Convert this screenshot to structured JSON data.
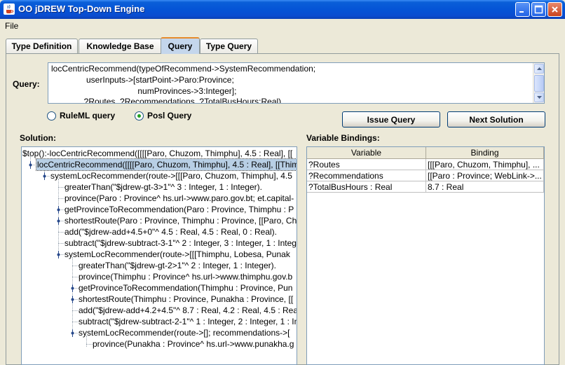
{
  "window": {
    "title": "OO jDREW Top-Down Engine"
  },
  "menu": {
    "file": "File"
  },
  "tabs": [
    {
      "label": "Type Definition"
    },
    {
      "label": "Knowledge Base"
    },
    {
      "label": "Query",
      "active": true
    },
    {
      "label": "Type Query"
    }
  ],
  "query": {
    "label": "Query:",
    "lines": [
      "locCentricRecommend(typeOfRecommend->SystemRecommendation;",
      "               userInputs->[startPoint->Paro:Province;",
      "                                     numProvinces->3:Integer];",
      "              ?Routes, ?Recommendations, ?TotalBusHours:Real)"
    ]
  },
  "options": {
    "ruleml": {
      "label": "RuleML query",
      "selected": false
    },
    "posl": {
      "label": "Posl Query",
      "selected": true
    }
  },
  "buttons": {
    "issue": "Issue Query",
    "next": "Next Solution"
  },
  "solution": {
    "label": "Solution:",
    "rows": [
      {
        "text": "$top():-locCentricRecommend([[[[Paro, Chuzom, Thimphu], 4.5 : Real], [["
      },
      {
        "text": "locCentricRecommend([[[[Paro, Chuzom, Thimphu], 4.5 : Real], [[Thim"
      },
      {
        "text": "systemLocRecommender(route->[[[Paro, Chuzom, Thimphu], 4.5"
      },
      {
        "text": "greaterThan(\"$jdrew-gt-3>1\"^ 3 : Integer, 1 : Integer)."
      },
      {
        "text": "province(Paro : Province^ hs.url->www.paro.gov.bt; et.capital-"
      },
      {
        "text": "getProvinceToRecommendation(Paro : Province, Thimphu : P"
      },
      {
        "text": "shortestRoute(Paro : Province, Thimphu : Province, [[Paro, Ch"
      },
      {
        "text": "add(\"$jdrew-add+4.5+0\"^ 4.5 : Real, 4.5 : Real, 0 : Real)."
      },
      {
        "text": "subtract(\"$jdrew-subtract-3-1\"^ 2 : Integer, 3 : Integer, 1 : Integ"
      },
      {
        "text": "systemLocRecommender(route->[[[Thimphu, Lobesa, Punak"
      },
      {
        "text": "greaterThan(\"$jdrew-gt-2>1\"^ 2 : Integer, 1 : Integer)."
      },
      {
        "text": "province(Thimphu : Province^ hs.url->www.thimphu.gov.b"
      },
      {
        "text": "getProvinceToRecommendation(Thimphu : Province, Pun"
      },
      {
        "text": "shortestRoute(Thimphu : Province, Punakha : Province, [["
      },
      {
        "text": "add(\"$jdrew-add+4.2+4.5\"^ 8.7 : Real, 4.2 : Real, 4.5 : Rea"
      },
      {
        "text": "subtract(\"$jdrew-subtract-2-1\"^ 1 : Integer, 2 : Integer, 1 : In"
      },
      {
        "text": "systemLocRecommender(route->[]; recommendations->["
      },
      {
        "text": "province(Punakha : Province^ hs.url->www.punakha.g"
      }
    ]
  },
  "bindings": {
    "label": "Variable Bindings:",
    "columns": [
      "Variable",
      "Binding"
    ],
    "rows": [
      [
        "?Routes",
        "[[[Paro, Chuzom, Thimphu], ..."
      ],
      [
        "?Recommendations",
        "[[Paro : Province; WebLink->..."
      ],
      [
        "?TotalBusHours : Real",
        "8.7 : Real"
      ]
    ]
  },
  "colors": {
    "titlebar": "#0554d6",
    "selection": "#b8cfe5",
    "tab_highlight": "#e68b2c"
  }
}
